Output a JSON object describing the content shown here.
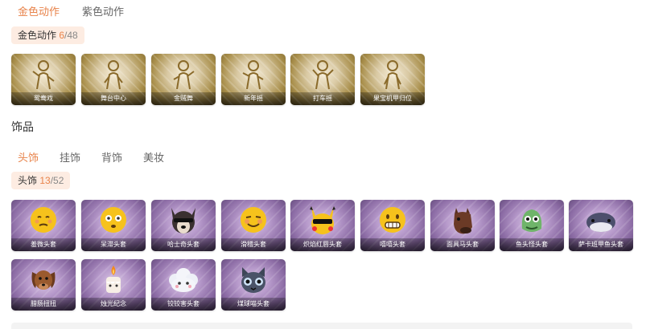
{
  "top_tabs": [
    "金色动作",
    "紫色动作"
  ],
  "gold_pill": {
    "label": "金色动作",
    "count": "6",
    "total": "/48"
  },
  "gold_actions": [
    "鸳鸯戏",
    "舞台中心",
    "金贼舞",
    "新年摇",
    "打车摇",
    "果宝机甲归位"
  ],
  "section_title": "饰品",
  "accessory_tabs": [
    "头饰",
    "挂饰",
    "背饰",
    "美妆"
  ],
  "headwear_pill": {
    "label": "头饰",
    "count": "13",
    "total": "/52"
  },
  "headwear_items": [
    "羞微头套",
    "呆滞头套",
    "哈士奇头套",
    "滑稽头套",
    "炽焰红唇头套",
    "嘻嘻头套",
    "面具马头套",
    "鱼头怪头套",
    "萨卡班甲鱼头套",
    "腊肠扭扭",
    "烛光纪念",
    "铰铰害头套",
    "煤球喵头套"
  ],
  "colors": {
    "accent": "#e8834a",
    "pill_bg": "#fdece2"
  }
}
